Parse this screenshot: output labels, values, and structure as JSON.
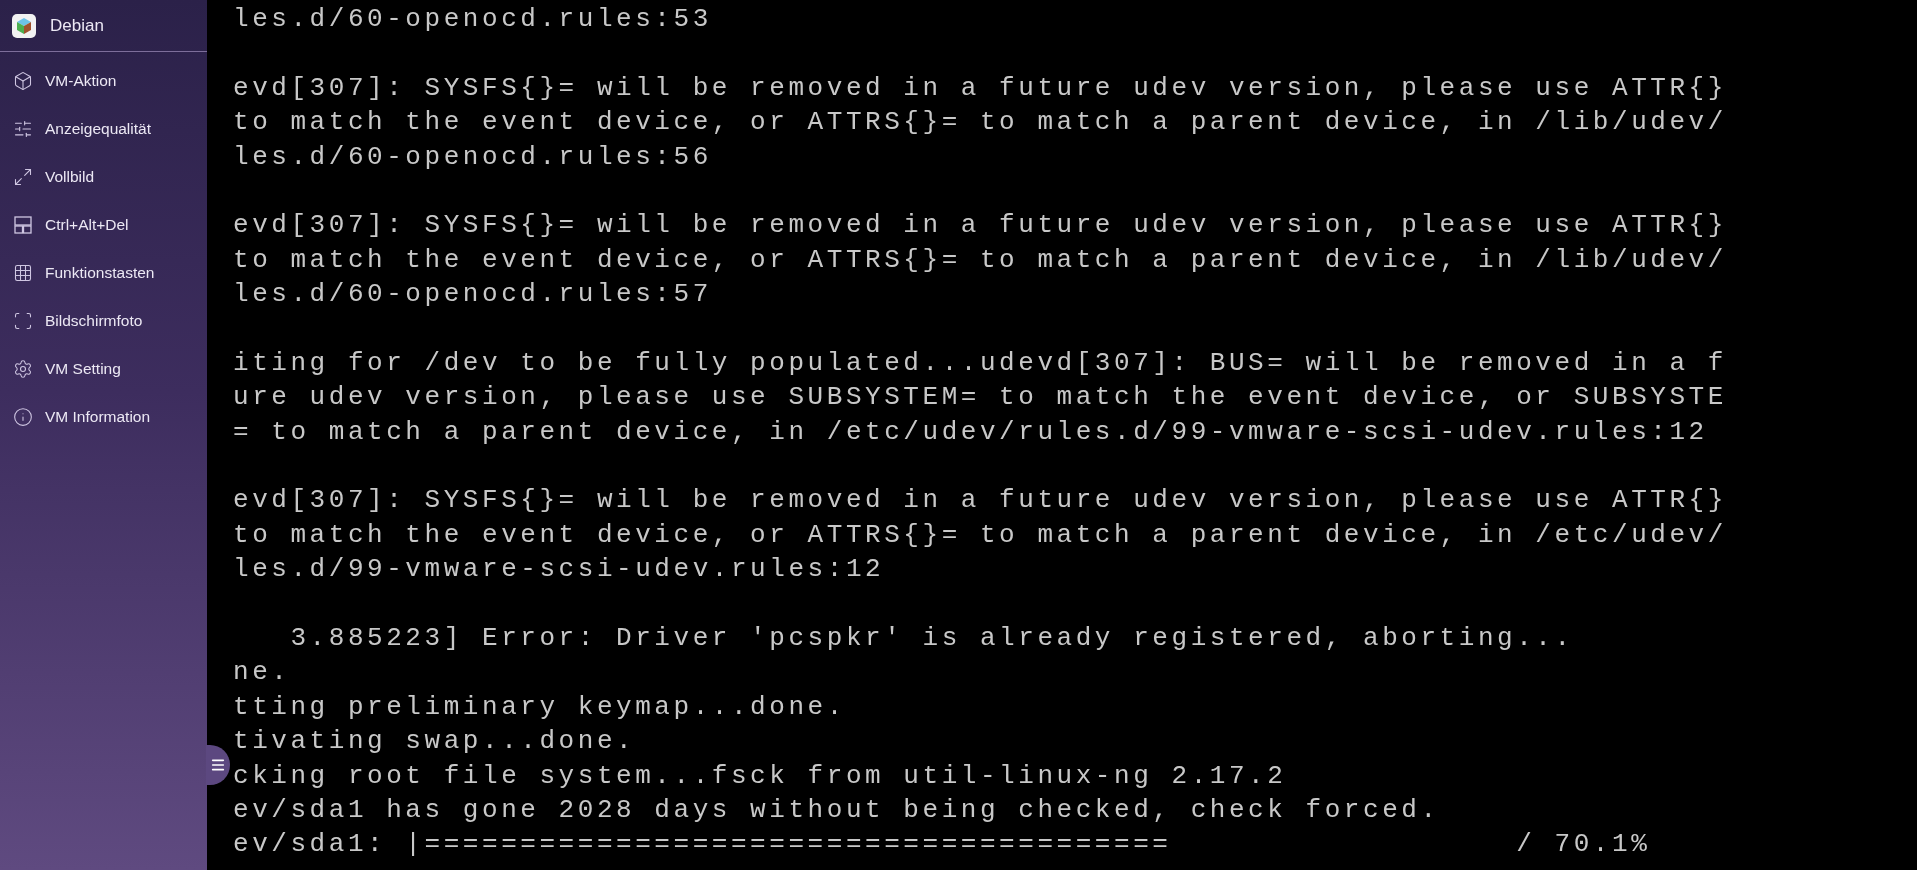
{
  "sidebar": {
    "title": "Debian",
    "items": [
      {
        "label": "VM-Aktion"
      },
      {
        "label": "Anzeigequalität"
      },
      {
        "label": "Vollbild"
      },
      {
        "label": "Ctrl+Alt+Del"
      },
      {
        "label": "Funktionstasten"
      },
      {
        "label": "Bildschirmfoto"
      },
      {
        "label": "VM Setting"
      },
      {
        "label": "VM Information"
      }
    ]
  },
  "console": {
    "blocks": [
      [
        "les.d/60-openocd.rules:53"
      ],
      [
        "evd[307]: SYSFS{}= will be removed in a future udev version, please use ATTR{}",
        "to match the event device, or ATTRS{}= to match a parent device, in /lib/udev/",
        "les.d/60-openocd.rules:56"
      ],
      [
        "evd[307]: SYSFS{}= will be removed in a future udev version, please use ATTR{}",
        "to match the event device, or ATTRS{}= to match a parent device, in /lib/udev/",
        "les.d/60-openocd.rules:57"
      ],
      [
        "iting for /dev to be fully populated...udevd[307]: BUS= will be removed in a f",
        "ure udev version, please use SUBSYSTEM= to match the event device, or SUBSYSTE",
        "= to match a parent device, in /etc/udev/rules.d/99-vmware-scsi-udev.rules:12"
      ],
      [
        "evd[307]: SYSFS{}= will be removed in a future udev version, please use ATTR{}",
        "to match the event device, or ATTRS{}= to match a parent device, in /etc/udev/",
        "les.d/99-vmware-scsi-udev.rules:12"
      ],
      [
        "   3.885223] Error: Driver 'pcspkr' is already registered, aborting...",
        "ne.",
        "tting preliminary keymap...done.",
        "tivating swap...done.",
        "cking root file system...fsck from util-linux-ng 2.17.2",
        "ev/sda1 has gone 2028 days without being checked, check forced.",
        "ev/sda1: |=======================================                  / 70.1%"
      ]
    ]
  }
}
